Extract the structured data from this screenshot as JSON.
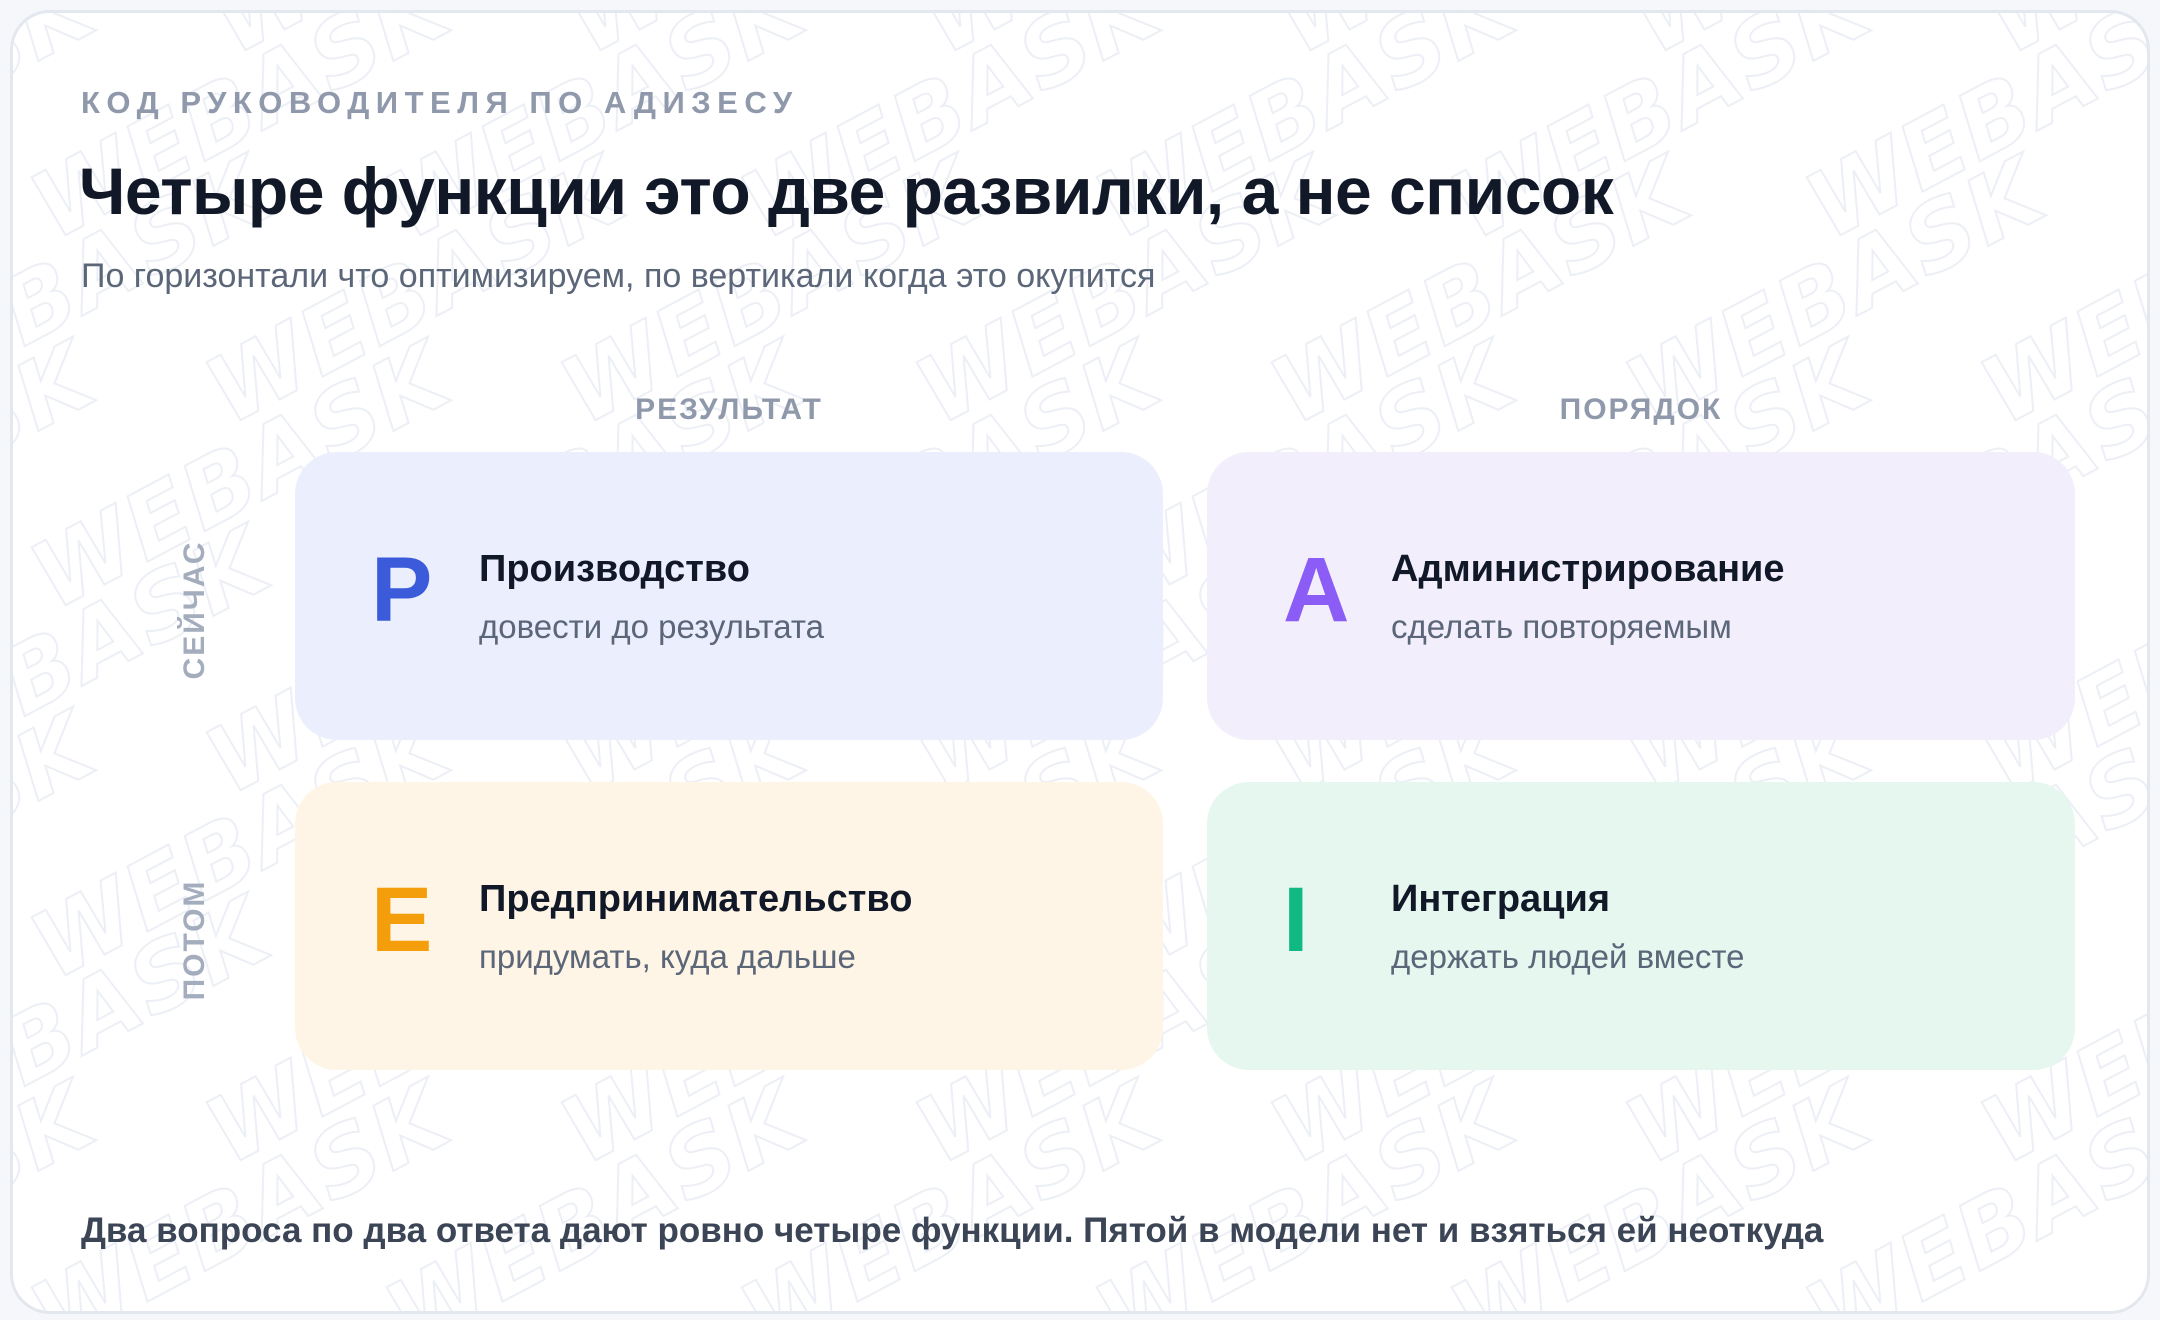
{
  "header": {
    "eyebrow": "КОД РУКОВОДИТЕЛЯ ПО АДИЗЕСУ",
    "title": "Четыре функции это две развилки, а не список",
    "subtitle": "По горизонтали что оптимизируем, по вертикали когда это окупится"
  },
  "axes": {
    "columns": [
      "РЕЗУЛЬТАТ",
      "ПОРЯДОК"
    ],
    "rows": [
      "СЕЙЧАС",
      "ПОТОМ"
    ]
  },
  "quadrants": [
    {
      "letter": "P",
      "name": "Производство",
      "description": "довести до результата",
      "accent": "#3b5bdb",
      "background": "#ebeefd"
    },
    {
      "letter": "A",
      "name": "Администрирование",
      "description": "сделать повторяемым",
      "accent": "#8b5cf6",
      "background": "#f2eefc"
    },
    {
      "letter": "E",
      "name": "Предпринимательство",
      "description": "придумать, куда дальше",
      "accent": "#f59e0b",
      "background": "#fff5e6"
    },
    {
      "letter": "I",
      "name": "Интеграция",
      "description": "держать людей вместе",
      "accent": "#10b981",
      "background": "#e6f7f0"
    }
  ],
  "footer": "Два вопроса по два ответа дают ровно четыре функции. Пятой в модели нет и взяться ей неоткуда",
  "watermark_text": "WEBASK"
}
